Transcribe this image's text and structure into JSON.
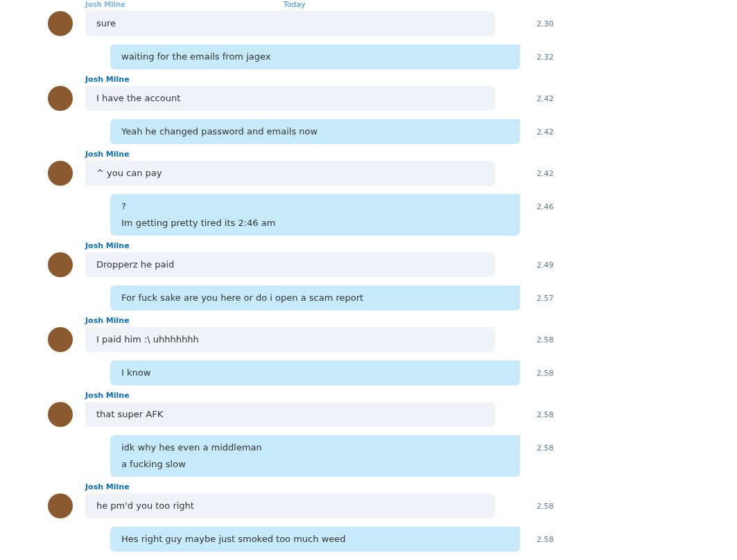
{
  "header": {
    "sender": "Josh Milne",
    "date": "Today"
  },
  "messages": [
    {
      "kind": "incoming",
      "lines": [
        "sure"
      ],
      "time": "2.30"
    },
    {
      "kind": "outgoing",
      "lines": [
        "waiting for the emails from jagex"
      ],
      "time": "2.32"
    },
    {
      "kind": "incoming",
      "sender": "Josh Milne",
      "lines": [
        "I have the account"
      ],
      "time": "2.42"
    },
    {
      "kind": "outgoing",
      "lines": [
        "Yeah he changed password and emails now"
      ],
      "time": "2.42"
    },
    {
      "kind": "incoming",
      "sender": "Josh Milne",
      "lines": [
        "^ you can pay"
      ],
      "time": "2.42"
    },
    {
      "kind": "outgoing",
      "lines": [
        "?",
        "Im getting pretty tired its 2:46 am"
      ],
      "time": "2.46"
    },
    {
      "kind": "incoming",
      "sender": "Josh Milne",
      "lines": [
        "Dropperz he paid"
      ],
      "time": "2.49"
    },
    {
      "kind": "outgoing",
      "lines": [
        "For fuck sake are you here or do i open a scam report"
      ],
      "time": "2.57"
    },
    {
      "kind": "incoming",
      "sender": "Josh Milne",
      "lines": [
        "I paid him :\\ uhhhhhhh"
      ],
      "time": "2.58"
    },
    {
      "kind": "outgoing",
      "lines": [
        "I know"
      ],
      "time": "2.58"
    },
    {
      "kind": "incoming",
      "sender": "Josh Milne",
      "lines": [
        "that super AFK"
      ],
      "time": "2.58"
    },
    {
      "kind": "outgoing",
      "lines": [
        "idk why hes even a middleman",
        "a fucking slow"
      ],
      "time": "2.58"
    },
    {
      "kind": "incoming",
      "sender": "Josh Milne",
      "lines": [
        "he pm'd you too right"
      ],
      "time": "2.58"
    },
    {
      "kind": "outgoing",
      "lines": [
        "Hes right guy maybe just smoked too much weed"
      ],
      "time": "2.58"
    }
  ]
}
